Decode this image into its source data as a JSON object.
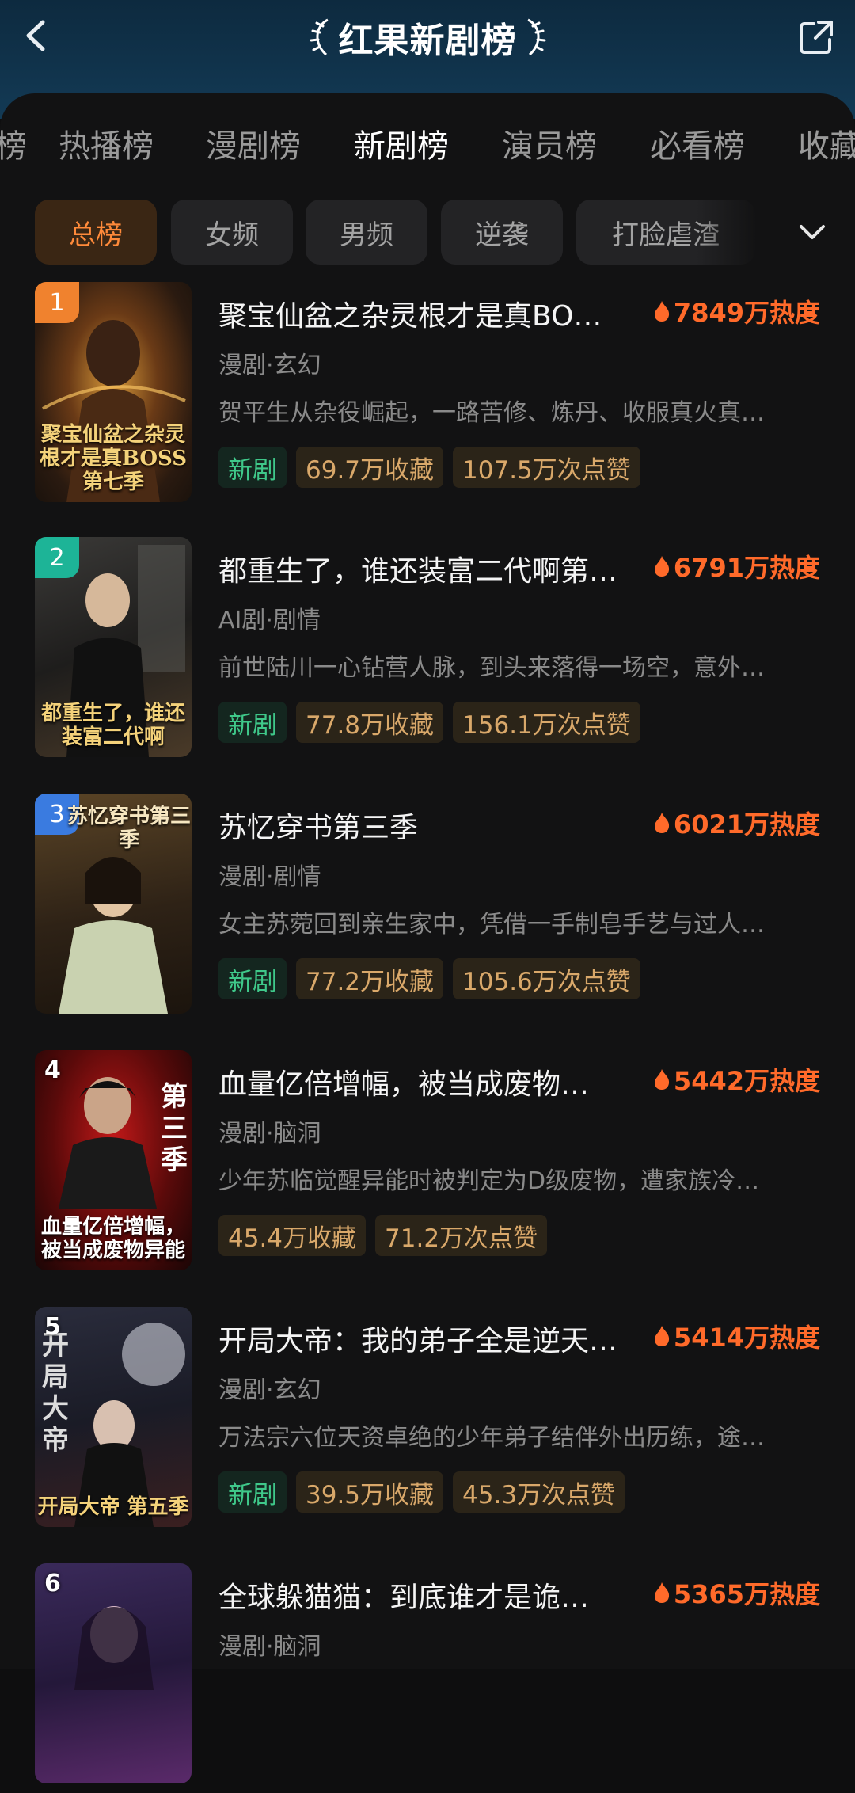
{
  "header": {
    "title": "红果新剧榜",
    "back_icon": "chevron-left-icon",
    "share_icon": "share-icon"
  },
  "tabs": [
    {
      "label": "热播榜",
      "active": false
    },
    {
      "label": "漫剧榜",
      "active": false
    },
    {
      "label": "新剧榜",
      "active": true
    },
    {
      "label": "演员榜",
      "active": false
    },
    {
      "label": "必看榜",
      "active": false
    },
    {
      "label": "收藏",
      "active": false
    }
  ],
  "filters": [
    {
      "label": "总榜",
      "active": true
    },
    {
      "label": "女频",
      "active": false
    },
    {
      "label": "男频",
      "active": false
    },
    {
      "label": "逆袭",
      "active": false
    },
    {
      "label": "打脸虐渣",
      "active": false
    }
  ],
  "items": [
    {
      "rank": "1",
      "title": "聚宝仙盆之杂灵根才是真BO…",
      "heat": "7849万热度",
      "genre": "漫剧·玄幻",
      "desc": "贺平生从杂役崛起，一路苦修、炼丹、收服真火真…",
      "new_tag": "新剧",
      "tags": [
        "69.7万收藏",
        "107.5万次点赞"
      ],
      "cover_caption": "聚宝仙盆之杂灵根才是真BOSS第七季"
    },
    {
      "rank": "2",
      "title": "都重生了，谁还装富二代啊第…",
      "heat": "6791万热度",
      "genre": "AI剧·剧情",
      "desc": "前世陆川一心钻营人脉，到头来落得一场空，意外…",
      "new_tag": "新剧",
      "tags": [
        "77.8万收藏",
        "156.1万次点赞"
      ],
      "cover_caption": "都重生了，谁还装富二代啊"
    },
    {
      "rank": "3",
      "title": "苏忆穿书第三季",
      "heat": "6021万热度",
      "genre": "漫剧·剧情",
      "desc": "女主苏菀回到亲生家中，凭借一手制皂手艺与过人…",
      "new_tag": "新剧",
      "tags": [
        "77.2万收藏",
        "105.6万次点赞"
      ],
      "cover_caption": "苏忆穿书第三季"
    },
    {
      "rank": "4",
      "title": "血量亿倍增幅，被当成废物…",
      "heat": "5442万热度",
      "genre": "漫剧·脑洞",
      "desc": "少年苏临觉醒异能时被判定为D级废物，遭家族冷…",
      "new_tag": "",
      "tags": [
        "45.4万收藏",
        "71.2万次点赞"
      ],
      "cover_caption": "血量亿倍增幅，被当成废物异能"
    },
    {
      "rank": "5",
      "title": "开局大帝：我的弟子全是逆天…",
      "heat": "5414万热度",
      "genre": "漫剧·玄幻",
      "desc": "万法宗六位天资卓绝的少年弟子结伴外出历练，途…",
      "new_tag": "新剧",
      "tags": [
        "39.5万收藏",
        "45.3万次点赞"
      ],
      "cover_caption": "开局大帝 第五季"
    },
    {
      "rank": "6",
      "title": "全球躲猫猫：到底谁才是诡…",
      "heat": "5365万热度",
      "genre": "漫剧·脑洞",
      "desc": "",
      "new_tag": "",
      "tags": [],
      "cover_caption": ""
    }
  ],
  "colors": {
    "header_bg": "#133a55",
    "accent_orange": "#ff6a2a",
    "new_tag_green": "#3fc88a",
    "rank1": "#f0822e",
    "rank2": "#1db497",
    "rank3": "#3a7be0"
  }
}
